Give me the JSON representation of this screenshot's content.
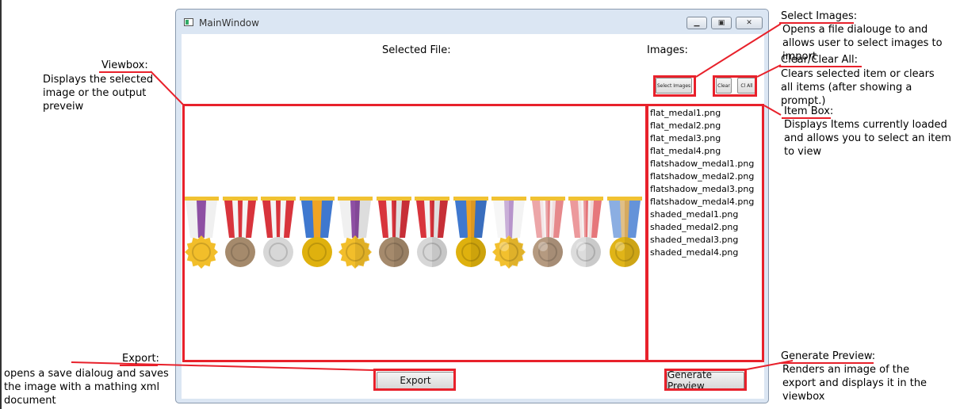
{
  "window": {
    "title": "MainWindow",
    "controls": [
      "minimize",
      "maximize",
      "close"
    ]
  },
  "main": {
    "selected_file_label": "Selected File:",
    "images_label": "Images:",
    "buttons": {
      "select_images": "Select Images",
      "clear": "Clear",
      "clear_all": "Cl All",
      "export": "Export",
      "generate_preview": "Generate Preview"
    },
    "items": [
      "flat_medal1.png",
      "flat_medal2.png",
      "flat_medal3.png",
      "flat_medal4.png",
      "flatshadow_medal1.png",
      "flatshadow_medal2.png",
      "flatshadow_medal3.png",
      "flatshadow_medal4.png",
      "shaded_medal1.png",
      "shaded_medal2.png",
      "shaded_medal3.png",
      "shaded_medal4.png"
    ],
    "medals": [
      {
        "ribbon": "#8e4fa3",
        "metal": "#f2be2a",
        "style": "flat"
      },
      {
        "ribbon": "#d8343c",
        "metal": "#a58a6c",
        "style": "flat"
      },
      {
        "ribbon": "#d8343c",
        "metal": "#d7d7d7",
        "style": "flat"
      },
      {
        "ribbon": "#f0a424",
        "metal": "#dfb10e",
        "style": "flat"
      },
      {
        "ribbon": "#8e4fa3",
        "metal": "#f2be2a",
        "style": "flatshadow"
      },
      {
        "ribbon": "#d8343c",
        "metal": "#a58a6c",
        "style": "flatshadow"
      },
      {
        "ribbon": "#d8343c",
        "metal": "#d7d7d7",
        "style": "flatshadow"
      },
      {
        "ribbon": "#f0a424",
        "metal": "#dfb10e",
        "style": "flatshadow"
      },
      {
        "ribbon": "#a77cc0",
        "metal": "#f2c02e",
        "style": "shaded"
      },
      {
        "ribbon": "#e06a6e",
        "metal": "#b59a80",
        "style": "shaded"
      },
      {
        "ribbon": "#e0555a",
        "metal": "#dcdcdc",
        "style": "shaded"
      },
      {
        "ribbon": "#f2b040",
        "metal": "#e0b418",
        "style": "shaded"
      }
    ]
  },
  "annotations": {
    "viewbox": {
      "title": "Viewbox:",
      "text": "Displays the selected image or the output preveiw"
    },
    "select_images": {
      "title": "Select Images:",
      "text": "Opens a file dialouge to and allows user to select images to import"
    },
    "clear": {
      "title": "Clear/Clear All:",
      "text": "Clears selected item or clears all items (after showing a prompt.)"
    },
    "item_box": {
      "title": "Item Box:",
      "text": "Displays Items currently loaded and allows you to select an item to view"
    },
    "export": {
      "title": "Export:",
      "text": "opens a save dialoug and saves the image with a mathing xml document"
    },
    "generate_preview": {
      "title": "Generate Preview:",
      "text": "Renders an image of the export and displays it in the viewbox"
    }
  },
  "colors": {
    "highlight": "#e8212b",
    "window_frame": "#dbe6f3"
  }
}
